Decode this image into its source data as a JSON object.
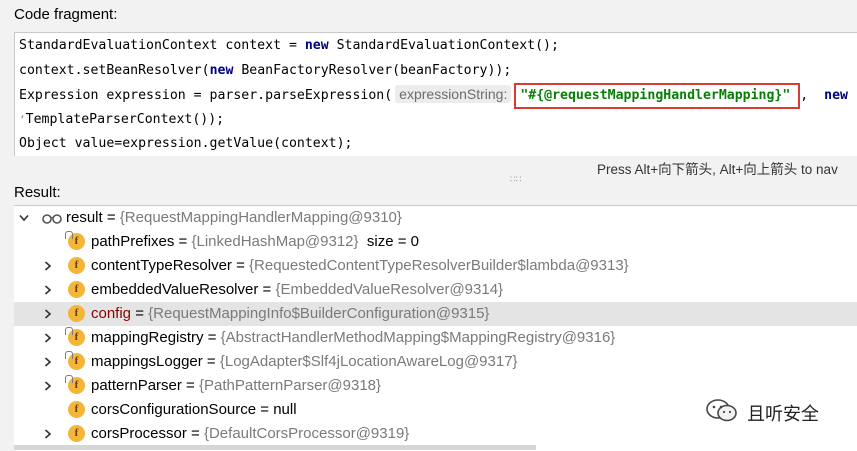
{
  "code_section": {
    "label": "Code fragment:",
    "lines": {
      "l1a": "StandardEvaluationContext context = ",
      "l1kw": "new",
      "l1b": " StandardEvaluationContext();",
      "l2a": "context.setBeanResolver(",
      "l2kw": "new",
      "l2b": " BeanFactoryResolver(beanFactory));",
      "l3a": "Expression expression = parser.parseExpression(",
      "l3hint": "expressionString:",
      "l3str": "\"#{@requestMappingHandlerMapping}\"",
      "l3b": ",",
      "l3kw": "new",
      "l4glyph": "‘",
      "l4a": "TemplateParserContext());",
      "l5a": "Object value=expression.getValue(context);"
    },
    "highlight_color": "#d93a32"
  },
  "hint_bar": {
    "text": "Press Alt+向下箭头, Alt+向上箭头 to nav"
  },
  "splitter": {
    "glyph": "∷∷"
  },
  "result_section": {
    "label": "Result:",
    "rows": [
      {
        "name": "result",
        "eq": " = ",
        "value": "{RequestMappingHandlerMapping@9310}"
      },
      {
        "name": "pathPrefixes",
        "eq": " = ",
        "value": "{LinkedHashMap@9312}",
        "extra": "size = 0"
      },
      {
        "name": "contentTypeResolver",
        "eq": " = ",
        "value": "{RequestedContentTypeResolverBuilder$lambda@9313}"
      },
      {
        "name": "embeddedValueResolver",
        "eq": " = ",
        "value": "{EmbeddedValueResolver@9314}"
      },
      {
        "name": "config",
        "eq": " = ",
        "value": "{RequestMappingInfo$BuilderConfiguration@9315}"
      },
      {
        "name": "mappingRegistry",
        "eq": " = ",
        "value": "{AbstractHandlerMethodMapping$MappingRegistry@9316}"
      },
      {
        "name": "mappingsLogger",
        "eq": " = ",
        "value": "{LogAdapter$Slf4jLocationAwareLog@9317}"
      },
      {
        "name": "patternParser",
        "eq": " = ",
        "value": "{PathPatternParser@9318}"
      },
      {
        "name": "corsConfigurationSource",
        "eq": " = ",
        "value": "null"
      },
      {
        "name": "corsProcessor",
        "eq": " = ",
        "value": "{DefaultCorsProcessor@9319}"
      }
    ],
    "field_icon_letter": "f",
    "selected_index": 4
  },
  "watermark": {
    "text": "且听安全",
    "icon": "wechat-icon"
  }
}
